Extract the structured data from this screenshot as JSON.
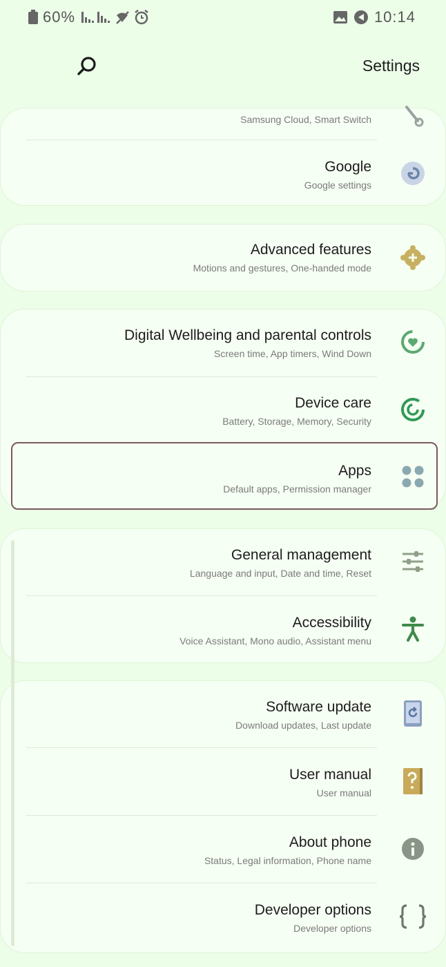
{
  "status_bar": {
    "time": "10:14",
    "battery": "60%",
    "icons": [
      "gallery-icon",
      "navigation-icon",
      "signal-icon",
      "wifi-off-icon",
      "alarm-icon",
      "battery-icon"
    ]
  },
  "header": {
    "title": "Settings",
    "search_icon": "search-icon"
  },
  "rows": {
    "accounts": {
      "subtitle": "Samsung Cloud, Smart Switch",
      "icon": "key-icon"
    },
    "google": {
      "title": "Google",
      "subtitle": "Google settings",
      "icon": "google-icon"
    },
    "advanced": {
      "title": "Advanced features",
      "subtitle": "Motions and gestures, One-handed mode",
      "icon": "puzzle-gear-icon"
    },
    "wellbeing": {
      "title": "Digital Wellbeing and parental controls",
      "subtitle": "Screen time, App timers, Wind Down",
      "icon": "wellbeing-icon"
    },
    "device_care": {
      "title": "Device care",
      "subtitle": "Battery, Storage, Memory, Security",
      "icon": "device-care-icon"
    },
    "apps": {
      "title": "Apps",
      "subtitle": "Default apps, Permission manager",
      "icon": "apps-grid-icon"
    },
    "general": {
      "title": "General management",
      "subtitle": "Language and input, Date and time, Reset",
      "icon": "sliders-icon"
    },
    "accessibility": {
      "title": "Accessibility",
      "subtitle": "Voice Assistant, Mono audio, Assistant menu",
      "icon": "accessibility-icon"
    },
    "software": {
      "title": "Software update",
      "subtitle": "Download updates, Last update",
      "icon": "software-update-icon"
    },
    "manual": {
      "title": "User manual",
      "subtitle": "User manual",
      "icon": "help-book-icon"
    },
    "about": {
      "title": "About phone",
      "subtitle": "Status, Legal information, Phone name",
      "icon": "info-icon"
    },
    "developer": {
      "title": "Developer options",
      "subtitle": "Developer options",
      "icon": "braces-icon"
    }
  },
  "colors": {
    "background": "#ecfde8",
    "card": "#f6fff4",
    "highlight_border": "#7a5a5a"
  }
}
